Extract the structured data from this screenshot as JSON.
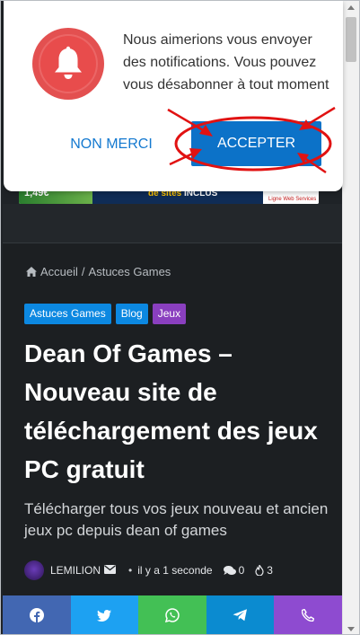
{
  "popup": {
    "message": "Nous aimerions vous envoyer des notifications. Vous pouvez vous désabonner à tout moment",
    "decline_label": "NON MERCI",
    "accept_label": "ACCEPTER",
    "colors": {
      "bell": "#e84c4c",
      "accept": "#0c72c8",
      "decline_text": "#1479d0",
      "annotation": "#e11212"
    }
  },
  "banner": {
    "left_text": "1,49€",
    "mid_text_prefix": "de sites",
    "mid_text_highlight": "INCLUS",
    "right_text": "Ligne Web Services"
  },
  "breadcrumb": {
    "home": "Accueil",
    "separator": "/",
    "current": "Astuces Games"
  },
  "categories": [
    {
      "label": "Astuces Games",
      "color": "#0c88e1"
    },
    {
      "label": "Blog",
      "color": "#0c88e1"
    },
    {
      "label": "Jeux",
      "color": "#8a3fbf"
    }
  ],
  "article": {
    "title": "Dean Of Games – Nouveau site de téléchargement des jeux PC gratuit",
    "subtitle": "Télécharger tous vos jeux nouveau et ancien jeux pc depuis dean of games"
  },
  "meta": {
    "author": "LEMILION",
    "dot": "•",
    "time": "il y a 1 seconde",
    "comments": "0",
    "views": "3"
  },
  "share": [
    {
      "name": "facebook",
      "color": "#4267b2"
    },
    {
      "name": "twitter",
      "color": "#1da1f2"
    },
    {
      "name": "whatsapp",
      "color": "#43c055"
    },
    {
      "name": "telegram",
      "color": "#0b8bd0"
    },
    {
      "name": "phone",
      "color": "#8e4bd0"
    }
  ]
}
